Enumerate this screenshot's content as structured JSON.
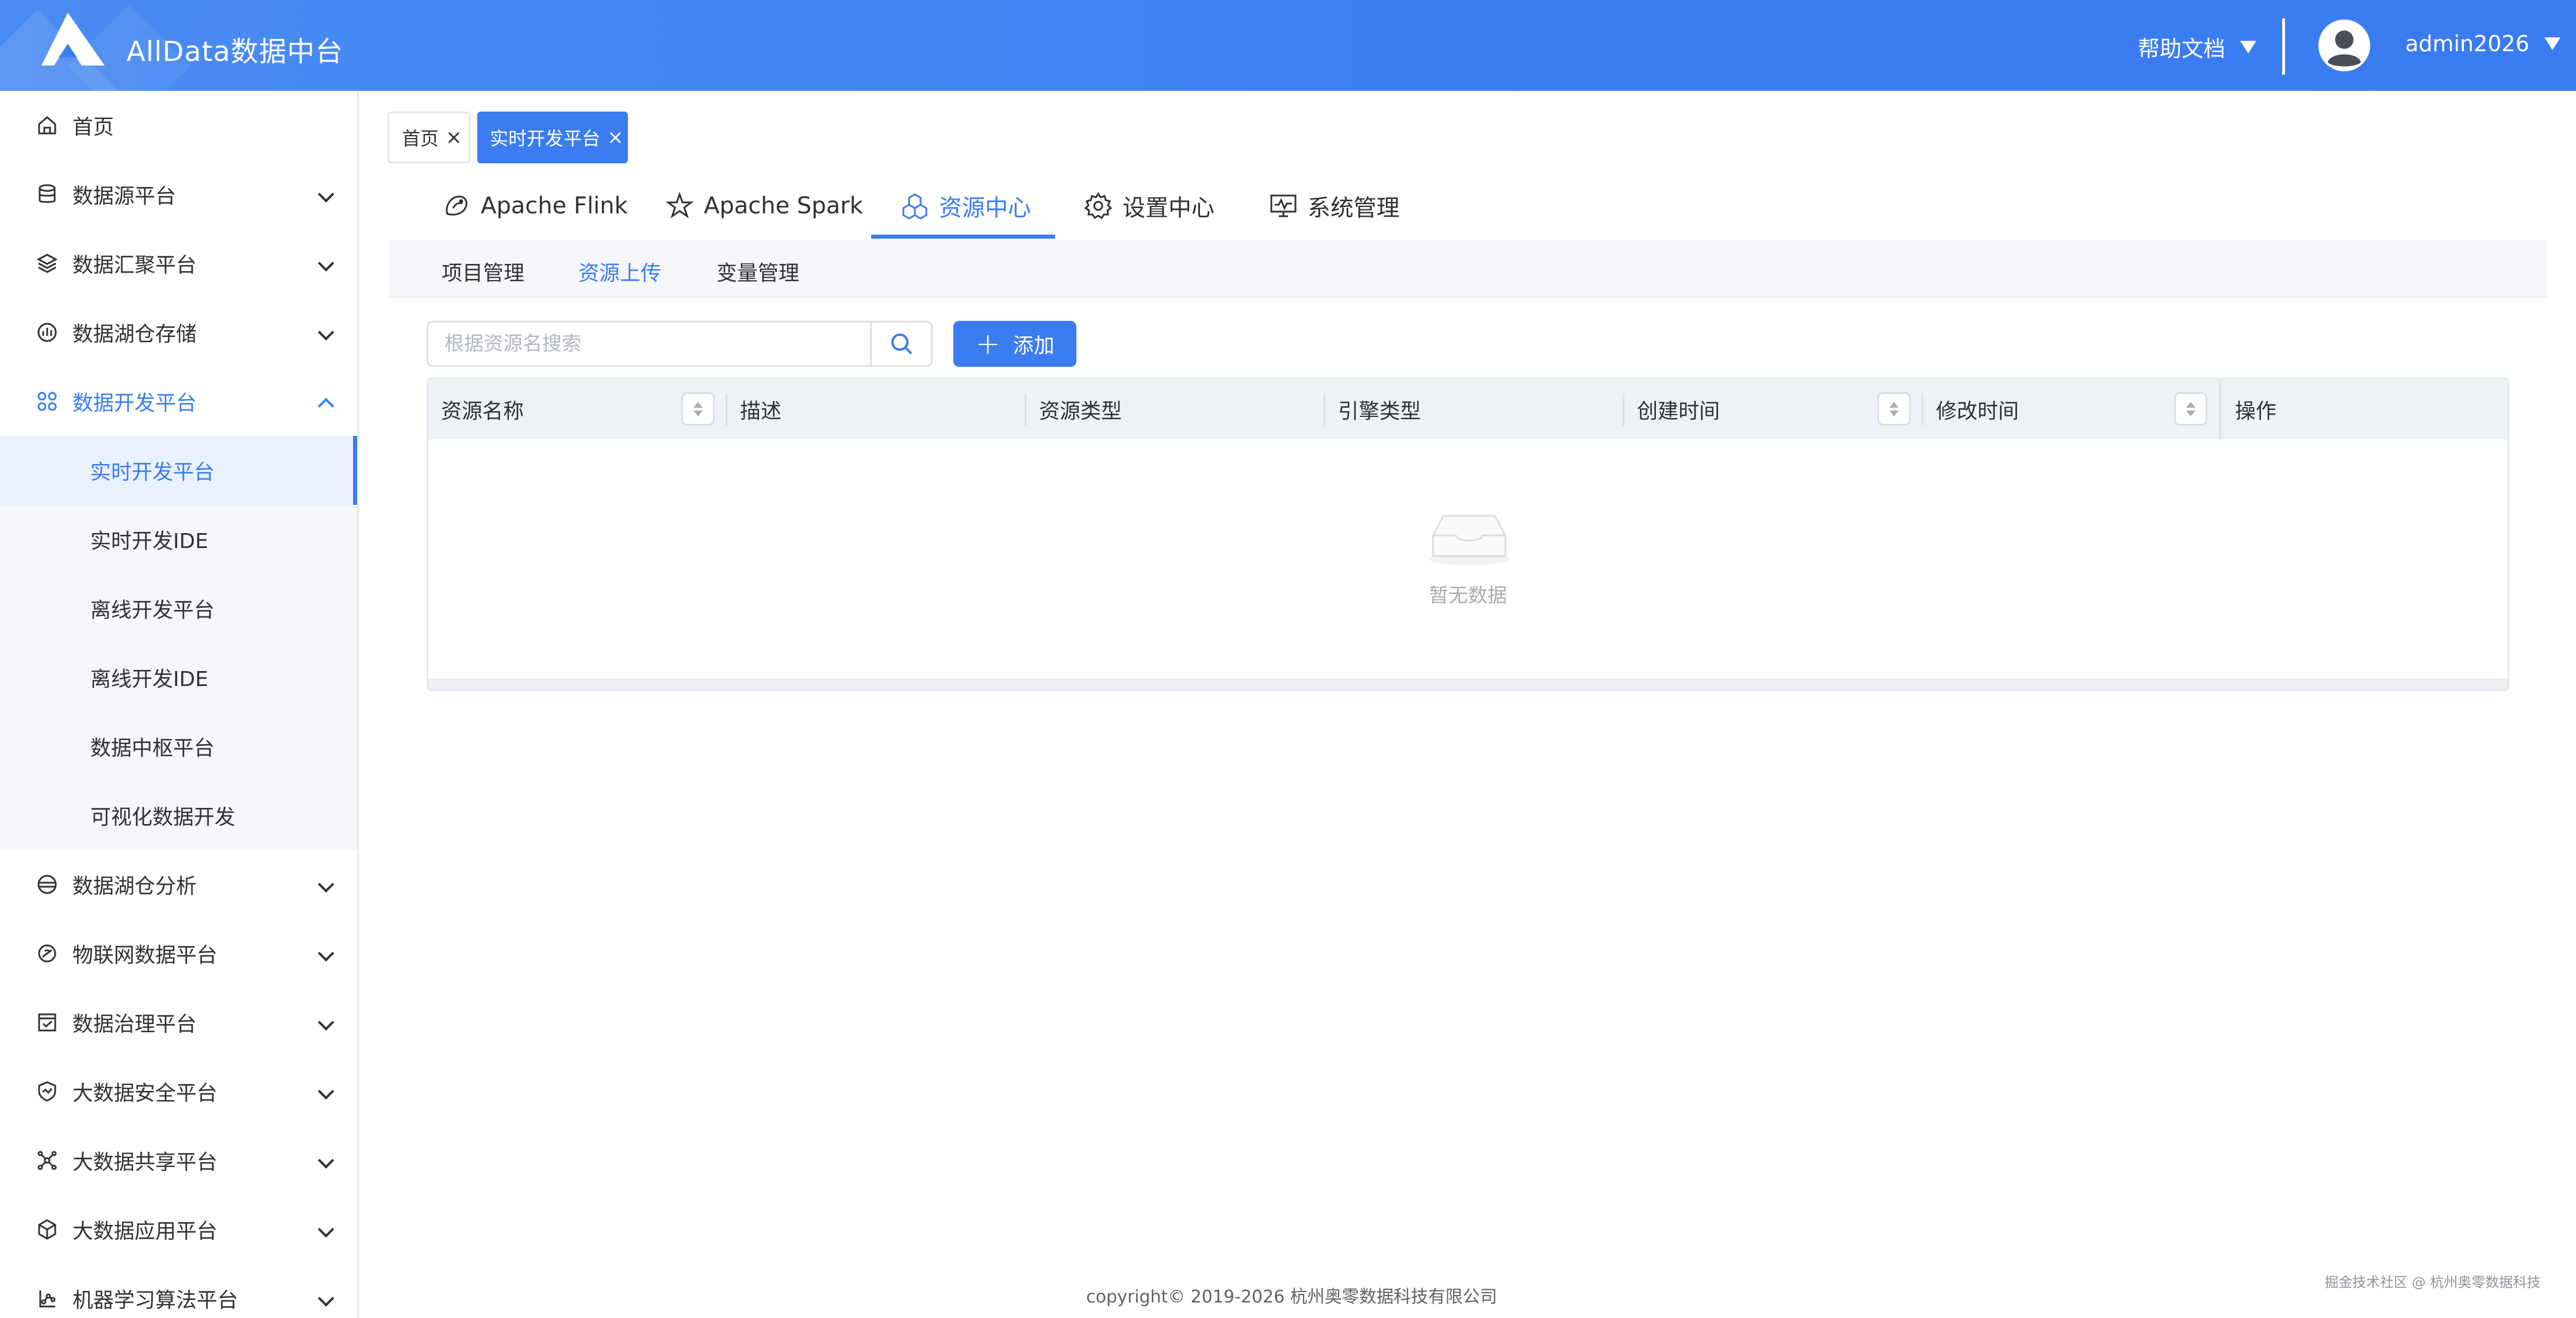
{
  "header": {
    "app_title": "AllData数据中台",
    "help_label": "帮助文档",
    "username": "admin2026"
  },
  "sidebar": {
    "items": [
      {
        "label": "首页",
        "icon": "home-icon",
        "expandable": false
      },
      {
        "label": "数据源平台",
        "icon": "database-icon",
        "expandable": true
      },
      {
        "label": "数据汇聚平台",
        "icon": "layers-icon",
        "expandable": true
      },
      {
        "label": "数据湖仓存储",
        "icon": "storage-icon",
        "expandable": true
      },
      {
        "label": "数据开发平台",
        "icon": "grid-icon",
        "expandable": true,
        "expanded": true
      },
      {
        "label": "数据湖仓分析",
        "icon": "analysis-icon",
        "expandable": true
      },
      {
        "label": "物联网数据平台",
        "icon": "iot-icon",
        "expandable": true
      },
      {
        "label": "数据治理平台",
        "icon": "governance-icon",
        "expandable": true
      },
      {
        "label": "大数据安全平台",
        "icon": "shield-icon",
        "expandable": true
      },
      {
        "label": "大数据共享平台",
        "icon": "share-icon",
        "expandable": true
      },
      {
        "label": "大数据应用平台",
        "icon": "cube-icon",
        "expandable": true
      },
      {
        "label": "机器学习算法平台",
        "icon": "ml-icon",
        "expandable": true
      }
    ],
    "submenu": [
      {
        "label": "实时开发平台",
        "active": true
      },
      {
        "label": "实时开发IDE"
      },
      {
        "label": "离线开发平台"
      },
      {
        "label": "离线开发IDE"
      },
      {
        "label": "数据中枢平台"
      },
      {
        "label": "可视化数据开发"
      }
    ]
  },
  "tags": {
    "home": "首页",
    "current": "实时开发平台"
  },
  "top_tabs": [
    {
      "label": "Apache Flink",
      "icon": "flink-icon"
    },
    {
      "label": "Apache Spark",
      "icon": "spark-icon"
    },
    {
      "label": "资源中心",
      "icon": "resource-icon",
      "active": true
    },
    {
      "label": "设置中心",
      "icon": "gear-icon"
    },
    {
      "label": "系统管理",
      "icon": "monitor-icon"
    }
  ],
  "sub_tabs": [
    {
      "label": "项目管理"
    },
    {
      "label": "资源上传",
      "active": true
    },
    {
      "label": "变量管理"
    }
  ],
  "search": {
    "placeholder": "根据资源名搜索",
    "value": ""
  },
  "add_button": {
    "label": "添加"
  },
  "table": {
    "columns": [
      {
        "label": "资源名称",
        "sortable": true
      },
      {
        "label": "描述",
        "sortable": false
      },
      {
        "label": "资源类型",
        "sortable": false
      },
      {
        "label": "引擎类型",
        "sortable": false
      },
      {
        "label": "创建时间",
        "sortable": true
      },
      {
        "label": "修改时间",
        "sortable": true
      },
      {
        "label": "操作",
        "sortable": false
      }
    ],
    "rows": [],
    "empty_text": "暂无数据"
  },
  "footer": {
    "copyright": "copyright© 2019-2026 杭州奥零数据科技有限公司",
    "watermark": "掘金技术社区 @ 杭州奥零数据科技"
  },
  "colors": {
    "accent": "#3b7cf0",
    "header_gradient_start": "#4a8cf3",
    "submenu_bg": "#f5f7fa",
    "table_header_bg": "#eef1f6"
  }
}
